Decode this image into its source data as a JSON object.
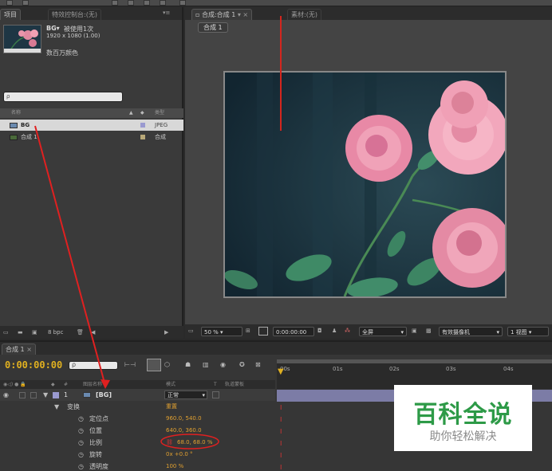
{
  "project_panel": {
    "tab_project": "项目",
    "tab_effects": "特效控制台:(无)",
    "item_name": "BG▾",
    "item_usage": "被使用1次",
    "item_size": "1920 x 1080 (1.00)",
    "item_color": "数百万颜色",
    "search_placeholder": "ρ",
    "col_name": "名称",
    "col_type": "类型",
    "rows": [
      {
        "name": "BG",
        "type": "JPEG",
        "swatch": "#9a9ad0"
      },
      {
        "name": "合成 1",
        "type": "合成",
        "swatch": "#b8a878"
      }
    ],
    "footer_bpc": "8 bpc"
  },
  "comp_panel": {
    "tab_comp": "合成:合成 1",
    "tab_footage": "素材:(无)",
    "breadcrumb": "合成 1",
    "zoom": "50 %",
    "timecode": "0:00:00:00",
    "resolution": "全屏",
    "camera": "有效摄像机",
    "views": "1 视图"
  },
  "timeline": {
    "tab": "合成 1",
    "current_time": "0:00:00:00",
    "col_source": "图层名称",
    "col_mode": "模式",
    "col_t": "T",
    "col_trkmat": "轨道蒙板",
    "ruler_labels": [
      "00s",
      "01s",
      "02s",
      "03s",
      "04s"
    ],
    "layer": {
      "number": "1",
      "name": "[BG]",
      "mode": "正常"
    },
    "transform": {
      "label": "变换",
      "reset": "重置"
    },
    "properties": [
      {
        "name": "定位点",
        "value": "960.0, 540.0"
      },
      {
        "name": "位置",
        "value": "640.0, 360.0"
      },
      {
        "name": "比例",
        "value": "68.0, 68.0 %"
      },
      {
        "name": "旋转",
        "value": "0x +0.0 °"
      },
      {
        "name": "透明度",
        "value": "100 %"
      }
    ]
  },
  "watermark": {
    "title": "百科全说",
    "subtitle": "助你轻松解决"
  }
}
